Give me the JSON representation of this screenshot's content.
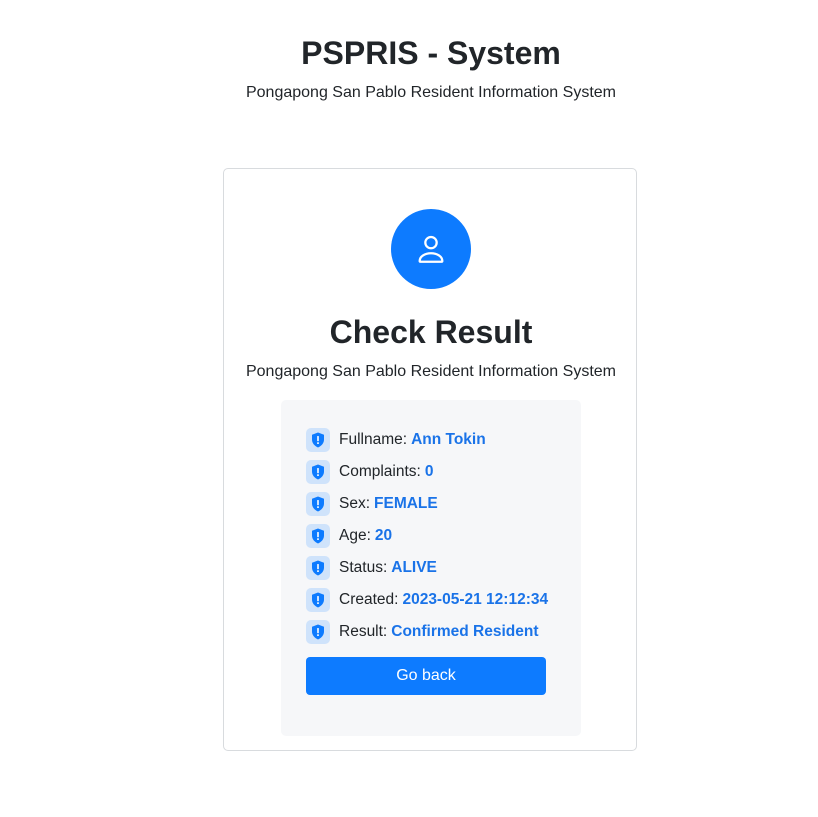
{
  "header": {
    "title": "PSPRIS - System",
    "subtitle": "Pongapong San Pablo Resident Information System"
  },
  "card": {
    "avatar_icon": "user-icon",
    "title": "Check Result",
    "subtitle": "Pongapong San Pablo Resident Information System",
    "accent_color": "#0d7bff",
    "value_color": "#1a73e8",
    "rows": [
      {
        "label": "Fullname:",
        "value": "Ann Tokin",
        "icon": "shield-alert-icon"
      },
      {
        "label": "Complaints:",
        "value": "0",
        "icon": "shield-alert-icon"
      },
      {
        "label": "Sex:",
        "value": "FEMALE",
        "icon": "shield-alert-icon"
      },
      {
        "label": "Age:",
        "value": "20",
        "icon": "shield-alert-icon"
      },
      {
        "label": "Status:",
        "value": "ALIVE",
        "icon": "shield-alert-icon"
      },
      {
        "label": "Created:",
        "value": "2023-05-21 12:12:34",
        "icon": "shield-alert-icon"
      },
      {
        "label": "Result:",
        "value": "Confirmed Resident",
        "icon": "shield-alert-icon"
      }
    ],
    "go_back_label": "Go back"
  }
}
